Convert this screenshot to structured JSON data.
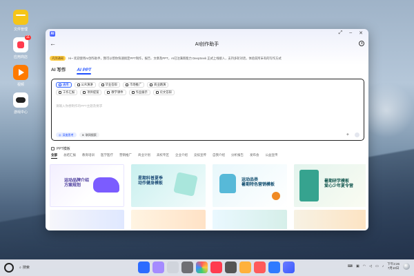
{
  "desktop": {
    "icons": [
      {
        "label": "文件管理",
        "color": "#f5c518",
        "badge": ""
      },
      {
        "label": "应用商店",
        "color": "#ffffff",
        "badge": "11"
      },
      {
        "label": "视频",
        "color": "#ff7a00",
        "badge": ""
      },
      {
        "label": "游戏中心",
        "color": "#ffffff",
        "badge": ""
      }
    ]
  },
  "window": {
    "title": "AI创作助手",
    "notice_tag": "内测通知",
    "notice_text": "Hi~ 欢迎使用AI创作助手，我可以帮你快速搞定PPT制作，报告、文章及PPT，AI已注满新能力 DeepSeek 正式上线接入，支持多轮对话，体验前所未有的写作方式",
    "modes": [
      {
        "label": "AI 写作",
        "active": false
      },
      {
        "label": "AI PPT",
        "active": true
      }
    ],
    "chips": [
      {
        "label": "通用",
        "selected": true
      },
      {
        "label": "公众演讲",
        "selected": false
      },
      {
        "label": "毕业答辩",
        "selected": false
      },
      {
        "label": "市场推广",
        "selected": false
      },
      {
        "label": "商业路演",
        "selected": false
      },
      {
        "label": "工作汇报",
        "selected": false
      },
      {
        "label": "项目提案",
        "selected": false
      },
      {
        "label": "教学课件",
        "selected": false
      },
      {
        "label": "作业展示",
        "selected": false
      },
      {
        "label": "论文答辩",
        "selected": false
      }
    ],
    "input_placeholder": "请输入你想制作的PPT主题及要求",
    "bottom_pills": [
      {
        "label": "深度思考"
      },
      {
        "label": "联网搜索"
      }
    ],
    "templates_heading": "PPT模板",
    "categories": [
      "全部",
      "总结汇报",
      "教育培训",
      "医学医疗",
      "营销推广",
      "商业计划",
      "高校专区",
      "企业介绍",
      "竞技宣传",
      "自我介绍",
      "分析报告",
      "发布会",
      "公益宣传"
    ],
    "thumbs": [
      {
        "title": "运动品牌介绍\n方案规划",
        "bg": "#ffffff",
        "accent": "#7b5cff",
        "title_color": "#4a3b9c"
      },
      {
        "title": "星期科普夏季\n动作健身模板",
        "bg": "#dff4f4",
        "accent": "#2dbdb3",
        "title_color": "#1f4e79"
      },
      {
        "title": "运动品类\n暑期特色营销模板",
        "bg": "#eaf7fa",
        "accent": "#2aa6c9",
        "title_color": "#0f4c6e"
      },
      {
        "title": "暑期研学模板\n爱心少年夏令营",
        "bg": "#f3f8e8",
        "accent": "#36a38f",
        "title_color": "#12574f"
      }
    ]
  },
  "taskbar": {
    "search_label": "搜索",
    "time": "下午2:26",
    "date": "7月10日"
  }
}
